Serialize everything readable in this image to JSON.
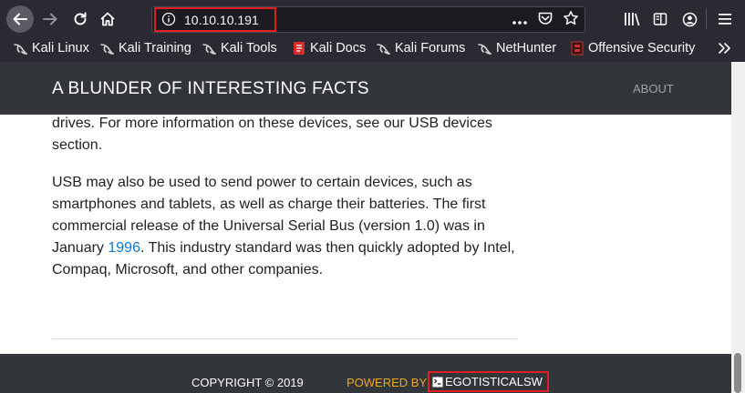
{
  "browser": {
    "url": "10.10.10.191",
    "bookmarks": [
      {
        "label": "Kali Linux",
        "icon": "kali-dragon-icon"
      },
      {
        "label": "Kali Training",
        "icon": "kali-dragon-icon"
      },
      {
        "label": "Kali Tools",
        "icon": "kali-dragon-icon"
      },
      {
        "label": "Kali Docs",
        "icon": "kali-docs-icon"
      },
      {
        "label": "Kali Forums",
        "icon": "kali-dragon-icon"
      },
      {
        "label": "NetHunter",
        "icon": "kali-dragon-icon"
      },
      {
        "label": "Offensive Security",
        "icon": "offsec-icon"
      }
    ]
  },
  "site": {
    "title": "A BLUNDER OF INTERESTING FACTS",
    "nav_about": "ABOUT"
  },
  "article": {
    "para1": "drives. For more information on these devices, see our USB devices section.",
    "para2_before": "USB may also be used to send power to certain devices, such as smartphones and tablets, as well as charge their batteries. The first commercial release of the Universal Serial Bus (version 1.0) was in January ",
    "para2_link": "1996",
    "para2_after": ". This industry standard was then quickly adopted by Intel, Compaq, Microsoft, and other companies."
  },
  "footer": {
    "copyright": "COPYRIGHT © 2019",
    "powered_by": "POWERED BY",
    "brand": "EGOTISTICALSW"
  },
  "colors": {
    "highlight": "#e02020",
    "link": "#0d7ad1",
    "powered": "#f0a818"
  }
}
